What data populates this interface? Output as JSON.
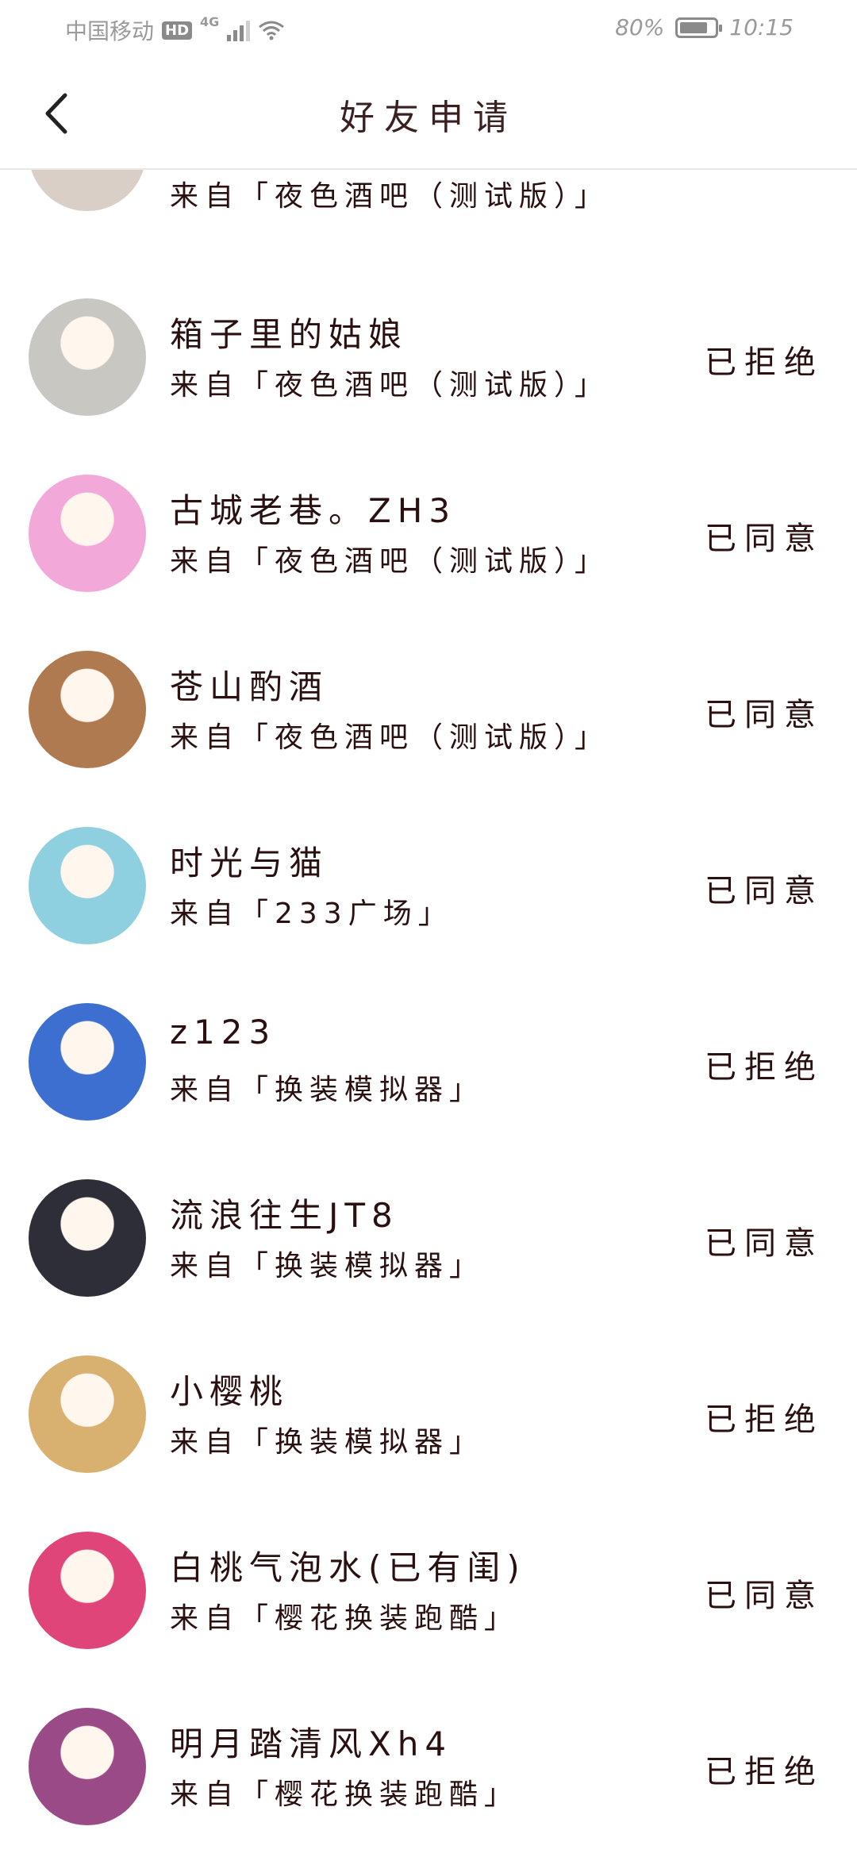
{
  "status_bar": {
    "carrier": "中国移动",
    "hd": "HD",
    "network": "4G",
    "battery_percent": "80%",
    "battery_level": 0.8,
    "time": "10:15"
  },
  "nav": {
    "title": "好友申请"
  },
  "requests": [
    {
      "name": "",
      "source": "来自「夜色酒吧（测试版）」",
      "status": "",
      "avatar_color": "#d9cfc6"
    },
    {
      "name": "箱子里的姑娘",
      "source": "来自「夜色酒吧（测试版）」",
      "status": "已拒绝",
      "avatar_color": "#c9c7c2"
    },
    {
      "name": "古城老巷。ZH3",
      "source": "来自「夜色酒吧（测试版）」",
      "status": "已同意",
      "avatar_color": "#f2a8d8"
    },
    {
      "name": "苍山酌酒",
      "source": "来自「夜色酒吧（测试版）」",
      "status": "已同意",
      "avatar_color": "#b07a50"
    },
    {
      "name": "时光与猫",
      "source": "来自「233广场」",
      "status": "已同意",
      "avatar_color": "#8fd0e0"
    },
    {
      "name": "z123",
      "source": "来自「换装模拟器」",
      "status": "已拒绝",
      "avatar_color": "#3c6fd0"
    },
    {
      "name": "流浪往生JT8",
      "source": "来自「换装模拟器」",
      "status": "已同意",
      "avatar_color": "#2e2e38"
    },
    {
      "name": "小樱桃",
      "source": "来自「换装模拟器」",
      "status": "已拒绝",
      "avatar_color": "#d8b070"
    },
    {
      "name": "白桃气泡水(已有闺)",
      "source": "来自「樱花换装跑酷」",
      "status": "已同意",
      "avatar_color": "#e0457a"
    },
    {
      "name": "明月踏清风Xh4",
      "source": "来自「樱花换装跑酷」",
      "status": "已拒绝",
      "avatar_color": "#9a4a86"
    }
  ]
}
